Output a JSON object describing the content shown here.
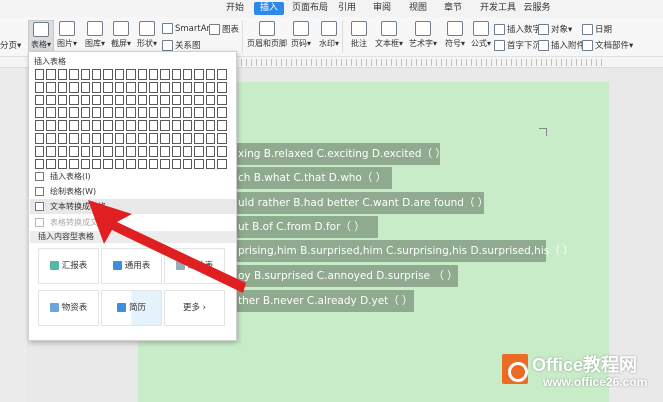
{
  "tabs": [
    "开始",
    "插入",
    "页面布局",
    "引用",
    "审阅",
    "视图",
    "章节",
    "开发工具",
    "云服务"
  ],
  "ribbon": {
    "fenye": "分页",
    "biaoge": "表格",
    "tupian": "图片",
    "tuku": "图库",
    "jieping": "截屏",
    "xingzhuang": "形状",
    "smartart": "SmartArt",
    "tubiao": "图表",
    "guanxitu": "关系图",
    "yemei": "页眉和页脚",
    "yema": "页码",
    "shuiyin": "水印",
    "pizhu": "批注",
    "wenbenkuang": "文本框",
    "yishuzi": "艺术字",
    "fuhao": "符号",
    "gongshi": "公式",
    "charushuzi": "插入数字",
    "duixiang": "对象",
    "riqi": "日期",
    "shouzixiachen": "首字下沉",
    "charufujian": "插入附件",
    "wendangbujian": "文档部件"
  },
  "dropdown": {
    "header": "插入表格",
    "items": [
      "插入表格(I)",
      "绘制表格(W)",
      "文本转换成表格...",
      "表格转换成文本..."
    ],
    "section": "插入内容型表格",
    "cards": [
      "汇报表",
      "通用表",
      "统计表",
      "物资表",
      "简历",
      "更多"
    ]
  },
  "doc_lines": [
    "xing  B.relaxed  C.exciting  D.excited（     ）",
    "ch  B.what  C.that  D.who（     ）",
    "uld  rather  B.had  better  C.want  D.are  found（     ）",
    "ut  B.of  C.from  D.for（     ）",
    "prising,him  B.surprised,him  C.surprising,his  D.surprised,his（     ）",
    "oy  B.surprised  C.annoyed  D.surprise  （     ）",
    "ther  B.never  C.already  D.yet（     ）"
  ],
  "watermark": {
    "title": "Office教程网",
    "url": "www.office26.com"
  },
  "colors": {
    "accent": "#2e88e8",
    "page": "#c8ecc8",
    "highlight": "#8faa8f",
    "arrow": "#e02020"
  }
}
